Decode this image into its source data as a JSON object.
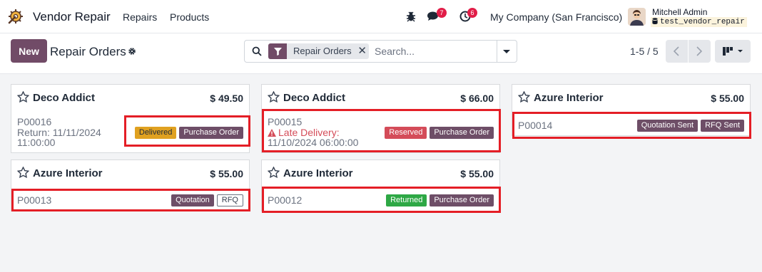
{
  "colors": {
    "brand": "#714b67",
    "highlight": "#e41e26",
    "tag_default": "#6e4e67",
    "tag_delivered": "#e0a120",
    "tag_reserved": "#d44c59",
    "tag_returned": "#2ea845",
    "notify": "#e11d48"
  },
  "navbar": {
    "logo_icon": "wrench-gear-icon",
    "app_name": "Vendor Repair",
    "menu": [
      "Repairs",
      "Products"
    ],
    "bug_icon": "bug-icon",
    "messages_icon": "chat-icon",
    "messages_count": "7",
    "activities_icon": "clock-icon",
    "activities_count": "6",
    "company": "My Company (San Francisco)",
    "user_name": "Mitchell Admin",
    "database": "test_vendor_repair"
  },
  "control": {
    "new_label": "New",
    "title": "Repair Orders",
    "facet_label": "Repair Orders",
    "search_placeholder": "Search...",
    "pager": "1-5 / 5",
    "view_icon": "kanban-view-icon"
  },
  "cards": [
    {
      "partner": "Deco Addict",
      "amount": "$ 49.50",
      "ref": "P00016",
      "line2": "Return: 11/11/2024",
      "line3": "11:00:00",
      "tags": [
        {
          "label": "Delivered",
          "style": "orange"
        },
        {
          "label": "Purchase Order",
          "style": "purple"
        }
      ]
    },
    {
      "partner": "Azure Interior",
      "amount": "$ 55.00",
      "ref": "P00013",
      "tags": [
        {
          "label": "Quotation",
          "style": "purple"
        },
        {
          "label": "RFQ",
          "style": "outline"
        }
      ]
    },
    {
      "partner": "Deco Addict",
      "amount": "$ 66.00",
      "ref": "P00015",
      "late_label": "Late Delivery:",
      "line3": "11/10/2024 06:00:00",
      "tags": [
        {
          "label": "Reserved",
          "style": "red"
        },
        {
          "label": "Purchase Order",
          "style": "purple"
        }
      ]
    },
    {
      "partner": "Azure Interior",
      "amount": "$ 55.00",
      "ref": "P00012",
      "tags": [
        {
          "label": "Returned",
          "style": "green"
        },
        {
          "label": "Purchase Order",
          "style": "purple"
        }
      ]
    },
    {
      "partner": "Azure Interior",
      "amount": "$ 55.00",
      "ref": "P00014",
      "tags": [
        {
          "label": "Quotation Sent",
          "style": "purple"
        },
        {
          "label": "RFQ Sent",
          "style": "purple"
        }
      ]
    }
  ]
}
